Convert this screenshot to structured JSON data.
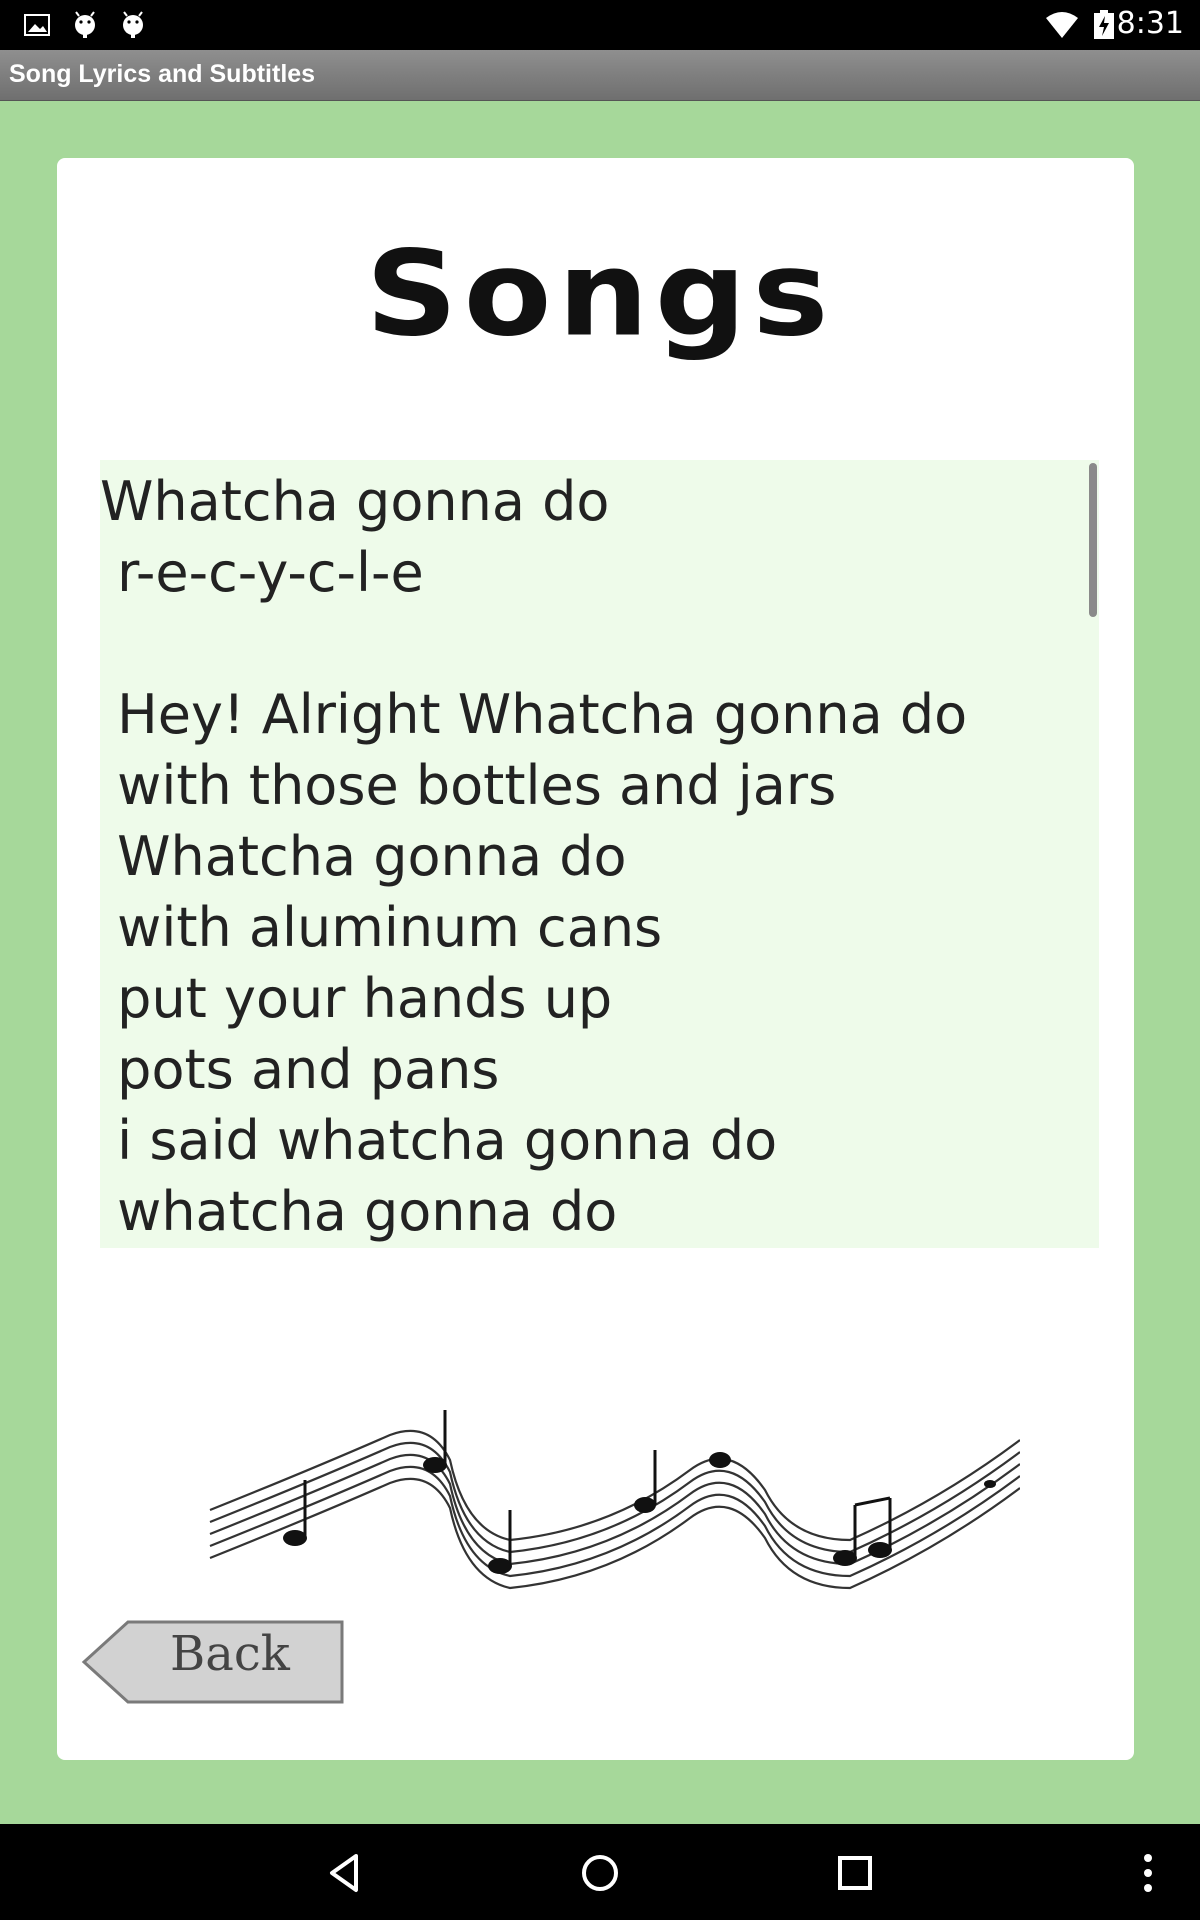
{
  "status_bar": {
    "time": "8:31"
  },
  "action_bar": {
    "title": "Song Lyrics and Subtitles"
  },
  "page": {
    "title": "Songs"
  },
  "lyrics": {
    "lines": [
      "Whatcha gonna do",
      " r-e-c-y-c-l-e",
      "",
      " Hey! Alright Whatcha gonna do",
      " with those bottles and jars",
      " Whatcha gonna do",
      " with aluminum cans",
      " put your hands up",
      " pots and pans",
      " i said whatcha gonna do",
      " whatcha gonna do"
    ]
  },
  "buttons": {
    "back_label": "Back"
  },
  "colors": {
    "page_background": "#a6d89a",
    "lyrics_background": "#eefbea"
  }
}
